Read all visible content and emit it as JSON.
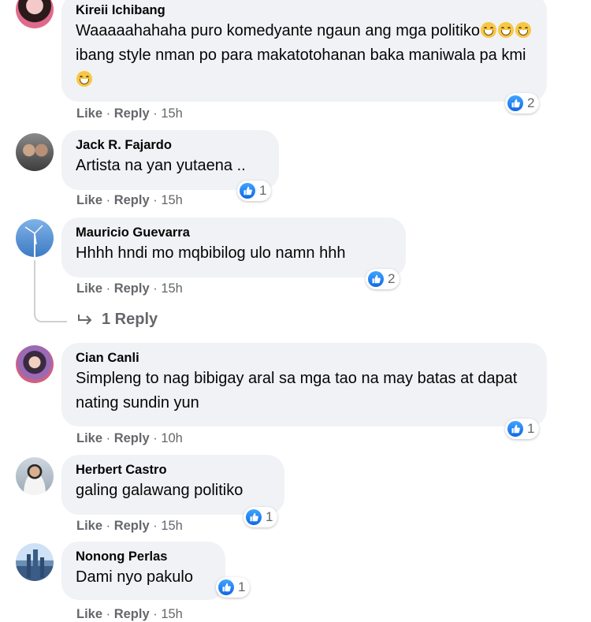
{
  "comments": [
    {
      "author": "Kireii Ichibang",
      "text_parts": [
        "Waaaaahahaha puro komedyante ngaun ang mga politiko",
        "ibang style nman po para makatotohanan baka maniwala pa kmi"
      ],
      "like_label": "Like",
      "reply_label": "Reply",
      "time": "15h",
      "reactions": "2"
    },
    {
      "author": "Jack R. Fajardo",
      "text": "Artista na yan yutaena ..",
      "like_label": "Like",
      "reply_label": "Reply",
      "time": "15h",
      "reactions": "1"
    },
    {
      "author": "Mauricio Guevarra",
      "text": "Hhhh hndi mo mqbibilog ulo namn hhh",
      "like_label": "Like",
      "reply_label": "Reply",
      "time": "15h",
      "reactions": "2",
      "replies_label": "1 Reply"
    },
    {
      "author": "Cian Canli",
      "text": "Simpleng to nag bibigay aral sa mga tao na may batas at dapat nating sundin yun",
      "like_label": "Like",
      "reply_label": "Reply",
      "time": "10h",
      "reactions": "1"
    },
    {
      "author": "Herbert Castro",
      "text": "galing galawang politiko",
      "like_label": "Like",
      "reply_label": "Reply",
      "time": "15h",
      "reactions": "1"
    },
    {
      "author": "Nonong Perlas",
      "text": "Dami nyo pakulo",
      "like_label": "Like",
      "reply_label": "Reply",
      "time": "15h",
      "reactions": "1"
    }
  ],
  "colors": {
    "bubble": "#f0f2f5",
    "meta": "#65676b",
    "like_blue": "#1877f2"
  }
}
